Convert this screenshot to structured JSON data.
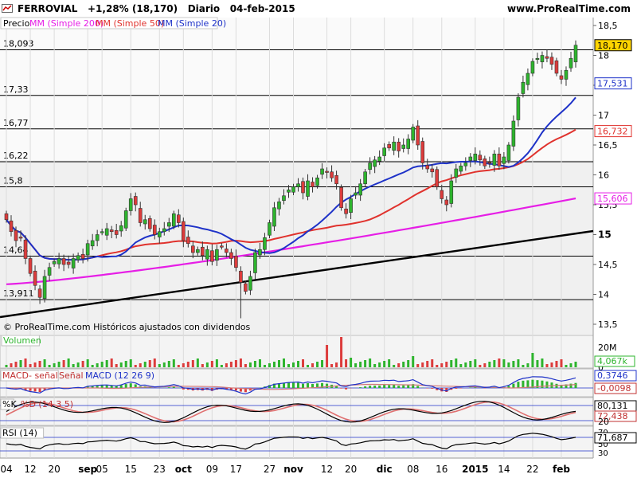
{
  "header": {
    "symbol": "FERROVIAL",
    "change": "+1,28% (18,170)",
    "period": "Diario",
    "date": "04-feb-2015",
    "site": "www.ProRealTime.com"
  },
  "legend": {
    "price": "Precio",
    "mm200": "MM (Simple 200)",
    "mm50": "MM (Simple 50)",
    "mm20": "MM (Simple 20)"
  },
  "copyright": "© ProRealTime.com Históricos ajustados con dividendos",
  "colors": {
    "up": "#2db42d",
    "down": "#dc3c3c",
    "mm20": "#1e32c8",
    "mm50": "#e0322d",
    "mm200": "#e61ee6",
    "trend": "#000000",
    "panel_bg": "#f2f2f2"
  },
  "chart_data": [
    {
      "type": "candlestick",
      "title": "FERROVIAL",
      "price_ticks": [
        "18,5",
        "18",
        "17,5",
        "17",
        "16,5",
        "16",
        "15,5",
        "15",
        "14,5",
        "14",
        "13,5"
      ],
      "ylim": [
        13.5,
        18.5
      ],
      "horizontal_levels": [
        18.093,
        17.33,
        16.77,
        16.22,
        15.8,
        14.64,
        13.911
      ],
      "horizontal_level_labels": [
        "18,093",
        "17,33",
        "16,77",
        "16,22",
        "15,8",
        "14,64",
        "13,911"
      ],
      "axis_labels": [
        {
          "label": "18,170",
          "kind": "last"
        },
        {
          "label": "17,531",
          "kind": "mm20"
        },
        {
          "label": "16,732",
          "kind": "mm50"
        },
        {
          "label": "15,606",
          "kind": "mm200"
        }
      ],
      "x_ticks": [
        "04",
        "12",
        "20",
        "sep",
        "05",
        "15",
        "23",
        "oct",
        "09",
        "17",
        "27",
        "nov",
        "12",
        "20",
        "dic",
        "08",
        "16",
        "2015",
        "14",
        "22",
        "feb"
      ],
      "dates": [
        "08-08",
        "11-08",
        "12-08",
        "13-08",
        "14-08",
        "18-08",
        "19-08",
        "20-08",
        "21-08",
        "22-08",
        "25-08",
        "26-08",
        "27-08",
        "28-08",
        "29-08",
        "01-09",
        "02-09",
        "03-09",
        "04-09",
        "05-09",
        "08-09",
        "09-09",
        "10-09",
        "11-09",
        "12-09",
        "15-09",
        "16-09",
        "17-09",
        "18-09",
        "19-09",
        "22-09",
        "23-09",
        "24-09",
        "25-09",
        "26-09",
        "29-09",
        "30-09",
        "01-10",
        "02-10",
        "03-10",
        "06-10",
        "07-10",
        "08-10",
        "09-10",
        "10-10",
        "13-10",
        "14-10",
        "15-10",
        "16-10",
        "17-10",
        "20-10",
        "21-10",
        "22-10",
        "23-10",
        "24-10",
        "27-10",
        "28-10",
        "29-10",
        "30-10",
        "31-10",
        "03-11",
        "04-11",
        "05-11",
        "06-11",
        "07-11",
        "10-11",
        "11-11",
        "12-11",
        "13-11",
        "14-11",
        "17-11",
        "18-11",
        "19-11",
        "20-11",
        "21-11",
        "24-11",
        "25-11",
        "26-11",
        "27-11",
        "28-11",
        "01-12",
        "02-12",
        "03-12",
        "04-12",
        "05-12",
        "08-12",
        "09-12",
        "10-12",
        "11-12",
        "12-12",
        "15-12",
        "16-12",
        "17-12",
        "18-12",
        "19-12",
        "22-12",
        "23-12",
        "29-12",
        "30-12",
        "02-01",
        "05-01",
        "07-01",
        "08-01",
        "09-01",
        "12-01",
        "13-01",
        "14-01",
        "15-01",
        "16-01",
        "19-01",
        "20-01",
        "21-01",
        "22-01",
        "23-01",
        "26-01",
        "27-01",
        "28-01",
        "29-01",
        "30-01",
        "02-02",
        "03-02",
        "04-02"
      ],
      "closes": [
        15.25,
        15.05,
        14.9,
        14.95,
        14.6,
        14.35,
        14.15,
        13.95,
        14.3,
        14.45,
        14.55,
        14.6,
        14.5,
        14.5,
        14.6,
        14.65,
        14.6,
        14.85,
        14.9,
        15.0,
        15.05,
        15.1,
        15.05,
        15.0,
        15.15,
        15.4,
        15.6,
        15.5,
        15.2,
        15.25,
        15.1,
        15.0,
        15.05,
        15.1,
        15.2,
        15.35,
        15.2,
        14.9,
        14.85,
        14.7,
        14.75,
        14.65,
        14.75,
        14.55,
        14.75,
        14.8,
        14.7,
        14.6,
        14.45,
        14.2,
        14.05,
        14.3,
        14.7,
        14.75,
        14.95,
        15.2,
        15.45,
        15.55,
        15.65,
        15.75,
        15.8,
        15.85,
        15.7,
        15.9,
        15.8,
        15.95,
        16.1,
        16.05,
        15.95,
        15.85,
        15.45,
        15.35,
        15.6,
        15.7,
        15.85,
        16.05,
        16.2,
        16.25,
        16.3,
        16.45,
        16.45,
        16.55,
        16.4,
        16.5,
        16.6,
        16.8,
        16.5,
        16.2,
        16.1,
        16.05,
        15.8,
        15.6,
        15.5,
        15.9,
        16.1,
        16.15,
        16.2,
        16.3,
        16.35,
        16.25,
        16.15,
        16.2,
        16.35,
        16.15,
        16.3,
        16.5,
        16.9,
        17.3,
        17.55,
        17.7,
        17.9,
        17.95,
        18.0,
        17.95,
        17.85,
        17.7,
        17.6,
        17.75,
        17.95,
        18.17
      ],
      "ma200_start": 14.17,
      "ma200_end": 15.606,
      "volume_ticks": [
        "20M",
        "0"
      ],
      "volume_last": "4,067k",
      "volume_label": "Volumen",
      "macd_label": "MACD- señal",
      "macd_label2": "Señal",
      "macd_label3": "MACD (12 26 9)",
      "macd_last": "0,3746",
      "macd_hist_last": "-0,0098",
      "stoch_label": "%K",
      "stoch_label2": "%D (14 3 5)",
      "stoch_ticks": [
        "80",
        "20"
      ],
      "stoch_k_last": "80,131",
      "stoch_d_last": "72,438",
      "rsi_label": "RSI (14)",
      "rsi_ticks": [
        "70",
        "50",
        "30"
      ],
      "rsi_last": "71,687"
    }
  ]
}
